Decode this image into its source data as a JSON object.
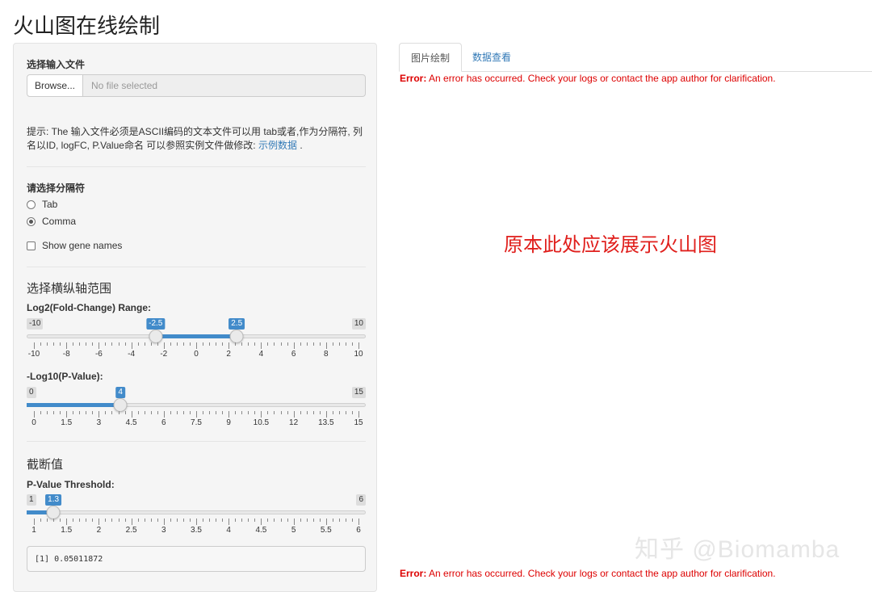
{
  "page": {
    "title": "火山图在线绘制"
  },
  "sidebar": {
    "file_input": {
      "label": "选择输入文件",
      "button": "Browse...",
      "placeholder": "No file selected"
    },
    "hint": {
      "text": "提示: The 输入文件必须是ASCII编码的文本文件可以用 tab或者,作为分隔符, 列名以ID, logFC, P.Value命名 可以参照实例文件做修改:",
      "link": "示例数据",
      "tail": "."
    },
    "separator": {
      "label": "请选择分隔符",
      "options": [
        {
          "label": "Tab",
          "checked": false
        },
        {
          "label": "Comma",
          "checked": true
        }
      ]
    },
    "show_gene_names": {
      "label": "Show gene names",
      "checked": false
    },
    "axis_section": {
      "title": "选择横纵轴范围"
    },
    "logfc_slider": {
      "label": "Log2(Fold-Change) Range:",
      "min": -10,
      "max": 10,
      "min_label": "-10",
      "max_label": "10",
      "value_low": -2.5,
      "value_high": 2.5,
      "value_low_label": "-2.5",
      "value_high_label": "2.5",
      "tick_labels": [
        "-10",
        "-8",
        "-6",
        "-4",
        "-2",
        "0",
        "2",
        "4",
        "6",
        "8",
        "10"
      ]
    },
    "pvalue_slider": {
      "label": "-Log10(P-Value):",
      "min": 0,
      "max": 15,
      "min_label": "0",
      "max_label": "15",
      "value": 4,
      "value_label": "4",
      "tick_labels": [
        "0",
        "1.5",
        "3",
        "4.5",
        "6",
        "7.5",
        "9",
        "10.5",
        "12",
        "13.5",
        "15"
      ]
    },
    "cutoff_section": {
      "title": "截断值"
    },
    "threshold_slider": {
      "label": "P-Value Threshold:",
      "min": 1,
      "max": 6,
      "min_label": "1",
      "max_label": "6",
      "value": 1.3,
      "value_label": "1.3",
      "tick_labels": [
        "1",
        "1.5",
        "2",
        "2.5",
        "3",
        "3.5",
        "4",
        "4.5",
        "5",
        "5.5",
        "6"
      ]
    },
    "output": {
      "text": "[1] 0.05011872"
    }
  },
  "main": {
    "tabs": [
      {
        "label": "图片绘制",
        "active": true
      },
      {
        "label": "数据查看",
        "active": false
      }
    ],
    "error": {
      "prefix": "Error:",
      "message": "An error has occurred. Check your logs or contact the app author for clarification."
    },
    "placeholder": "原本此处应该展示火山图",
    "watermark": "知乎 @Biomamba"
  },
  "colors": {
    "accent": "#428bca",
    "link": "#337ab7",
    "error": "#dd0000",
    "annotation": "#e0201d"
  }
}
